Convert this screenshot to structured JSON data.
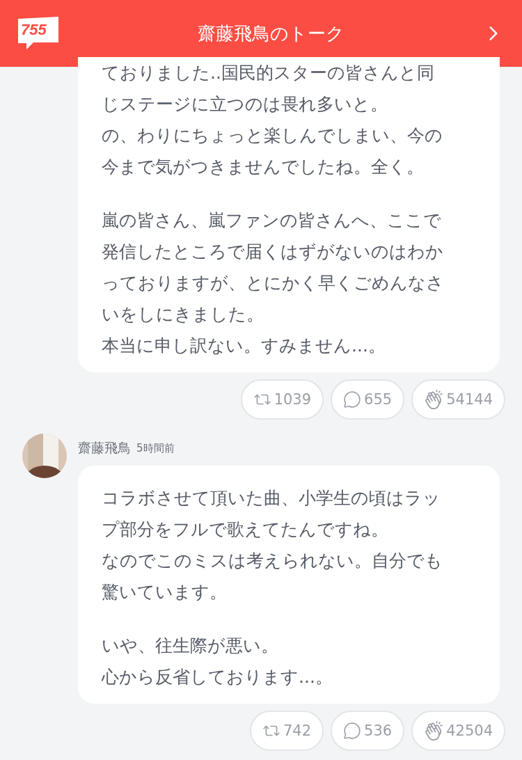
{
  "header": {
    "logo": "755",
    "title": "齋藤飛鳥のトーク"
  },
  "posts": [
    {
      "paragraphs": [
        [
          "ておりました..国民的スターの皆さんと同",
          "じステージに立つのは畏れ多いと。",
          "の、わりにちょっと楽しんでしまい、今の",
          "今まで気がつきませんでしたね。全く。"
        ],
        [
          "嵐の皆さん、嵐ファンの皆さんへ、ここで",
          "発信したところで届くはずがないのはわか",
          "っておりますが、とにかく早くごめんなさ",
          "いをしにきました。",
          "本当に申し訳ない。すみません...。"
        ]
      ],
      "reactions": [
        {
          "kind": "repost",
          "count": "1039"
        },
        {
          "kind": "comment",
          "count": "655"
        },
        {
          "kind": "clap",
          "count": "54144"
        }
      ]
    },
    {
      "author": "齋藤飛鳥",
      "time": "5時間前",
      "paragraphs": [
        [
          "コラボさせて頂いた曲、小学生の頃はラッ",
          "プ部分をフルで歌えてたんですね。",
          "なのでこのミスは考えられない。自分でも",
          "驚いています。"
        ],
        [
          "いや、往生際が悪い。",
          "心から反省しております...。"
        ]
      ],
      "reactions": [
        {
          "kind": "repost",
          "count": "742"
        },
        {
          "kind": "comment",
          "count": "536"
        },
        {
          "kind": "clap",
          "count": "42504"
        }
      ]
    }
  ]
}
